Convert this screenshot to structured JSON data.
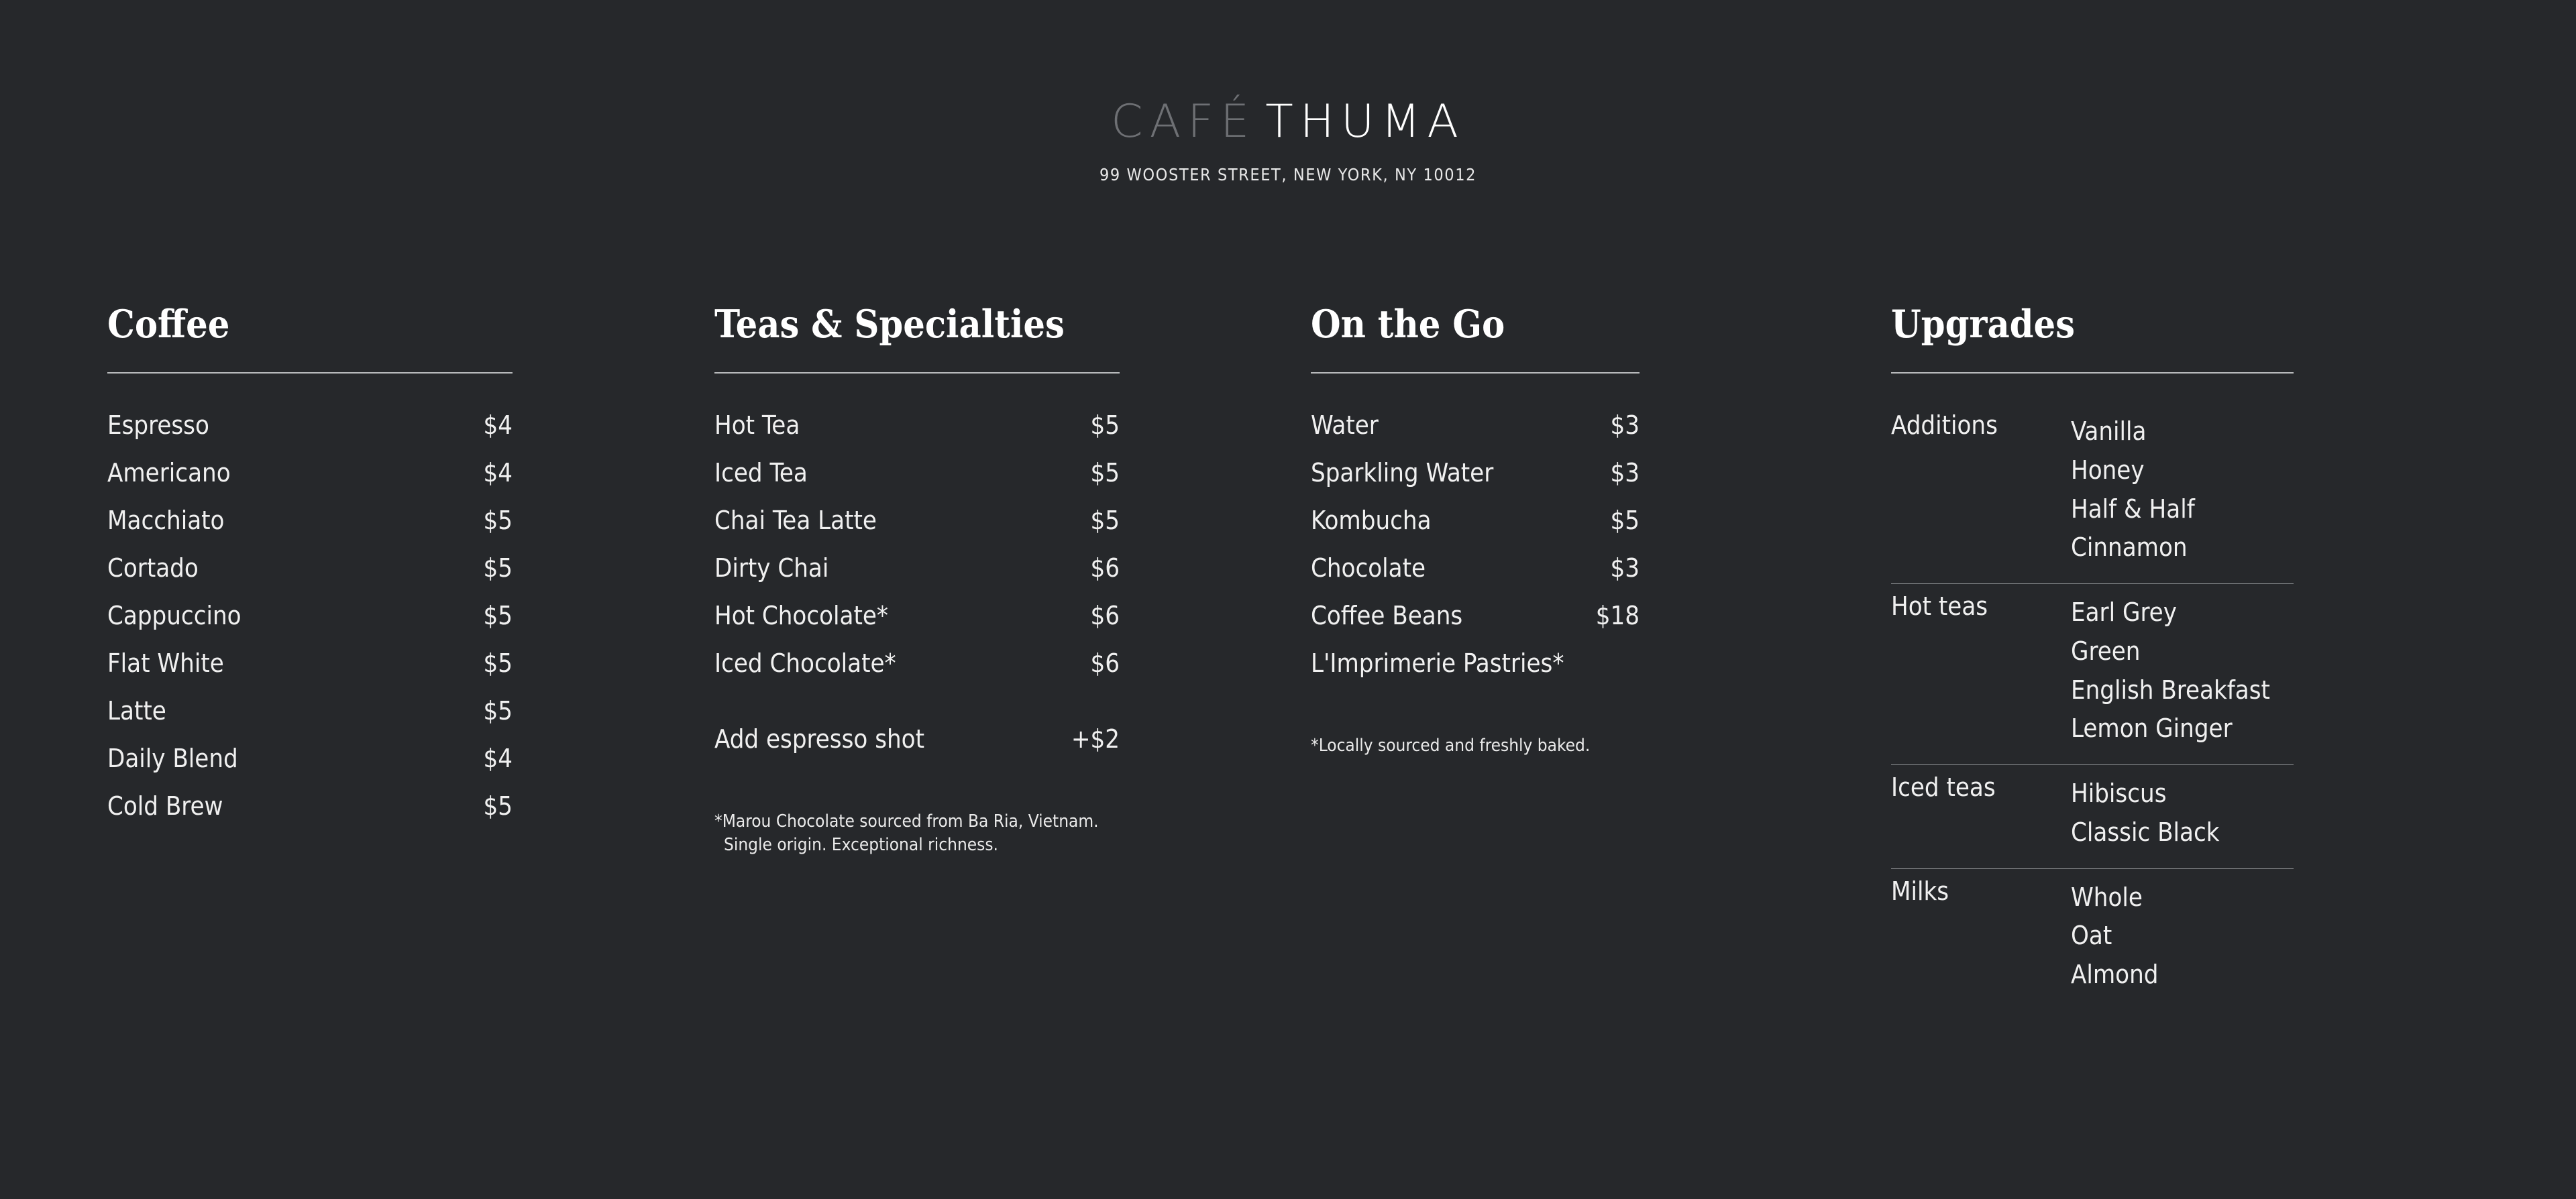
{
  "header": {
    "brand_primary": "CAFÉ",
    "brand_secondary": "THUMA",
    "address": "99 WOOSTER STREET, NEW YORK, NY 10012"
  },
  "colors": {
    "background": "#26282b",
    "text": "#f0f0f0",
    "muted_brand": "#6e7074",
    "rule": "#b9bbbd"
  },
  "columns": {
    "coffee": {
      "title": "Coffee",
      "items": [
        {
          "name": "Espresso",
          "price": "$4"
        },
        {
          "name": "Americano",
          "price": "$4"
        },
        {
          "name": "Macchiato",
          "price": "$5"
        },
        {
          "name": "Cortado",
          "price": "$5"
        },
        {
          "name": "Cappuccino",
          "price": "$5"
        },
        {
          "name": "Flat White",
          "price": "$5"
        },
        {
          "name": "Latte",
          "price": "$5"
        },
        {
          "name": "Daily Blend",
          "price": "$4"
        },
        {
          "name": "Cold Brew",
          "price": "$5"
        }
      ]
    },
    "teas": {
      "title": "Teas & Specialties",
      "items": [
        {
          "name": "Hot Tea",
          "price": "$5"
        },
        {
          "name": "Iced Tea",
          "price": "$5"
        },
        {
          "name": "Chai Tea Latte",
          "price": "$5"
        },
        {
          "name": "Dirty Chai",
          "price": "$6"
        },
        {
          "name": "Hot Chocolate*",
          "price": "$6"
        },
        {
          "name": "Iced Chocolate*",
          "price": "$6"
        }
      ],
      "addon": {
        "name": "Add espresso shot",
        "price": "+$2"
      },
      "footnote_line_1": "*Marou Chocolate sourced from Ba Ria, Vietnam.",
      "footnote_line_2": "Single origin. Exceptional richness."
    },
    "on_the_go": {
      "title": "On the Go",
      "items": [
        {
          "name": "Water",
          "price": "$3"
        },
        {
          "name": "Sparkling Water",
          "price": "$3"
        },
        {
          "name": "Kombucha",
          "price": "$5"
        },
        {
          "name": "Chocolate",
          "price": "$3"
        },
        {
          "name": "Coffee Beans",
          "price": "$18"
        },
        {
          "name": "L'Imprimerie Pastries*",
          "price": ""
        }
      ],
      "footnote_line_1": "*Locally sourced and freshly baked."
    },
    "upgrades": {
      "title": "Upgrades",
      "groups": [
        {
          "label": "Additions",
          "values": [
            "Vanilla",
            "Honey",
            "Half & Half",
            "Cinnamon"
          ]
        },
        {
          "label": "Hot teas",
          "values": [
            "Earl Grey",
            "Green",
            "English Breakfast",
            "Lemon Ginger"
          ]
        },
        {
          "label": "Iced teas",
          "values": [
            "Hibiscus",
            "Classic Black"
          ]
        },
        {
          "label": "Milks",
          "values": [
            "Whole",
            "Oat",
            "Almond"
          ]
        }
      ]
    }
  }
}
